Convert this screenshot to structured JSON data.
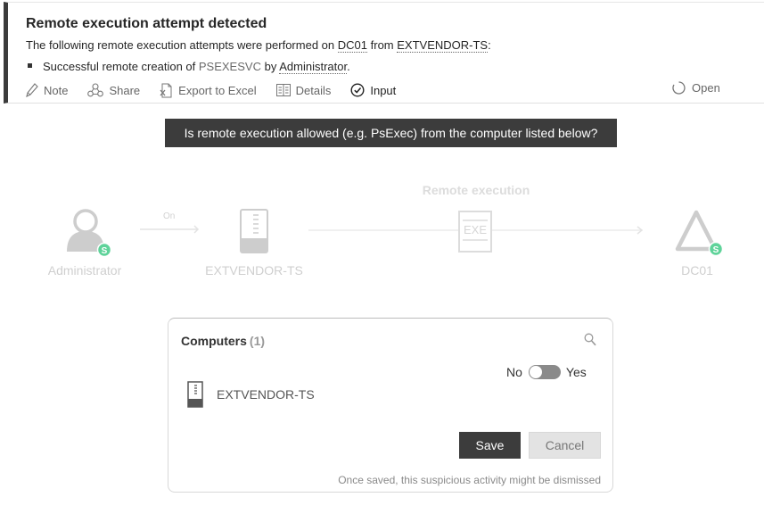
{
  "alert": {
    "title": "Remote execution attempt detected",
    "subtitle_prefix": "The following remote execution attempts were performed on",
    "target_computer": "DC01",
    "from_word": "from",
    "source_computer": "EXTVENDOR-TS",
    "colon": ":",
    "bullet_prefix": "Successful remote creation of",
    "service": "PSEXESVC",
    "by_word": "by",
    "user": "Administrator",
    "period": "."
  },
  "toolbar": {
    "note": "Note",
    "share": "Share",
    "export": "Export to Excel",
    "details": "Details",
    "input": "Input",
    "open": "Open"
  },
  "question": "Is remote execution allowed (e.g. PsExec) from the computer listed below?",
  "diagram": {
    "title": "Remote execution",
    "on_label": "On",
    "user_label": "Administrator",
    "source_label": "EXTVENDOR-TS",
    "target_label": "DC01",
    "exe_text": "EXE",
    "badge_letter": "S"
  },
  "panel": {
    "title": "Computers",
    "count": "(1)",
    "toggle_no": "No",
    "toggle_yes": "Yes",
    "computer_name": "EXTVENDOR-TS",
    "save_label": "Save",
    "cancel_label": "Cancel",
    "note": "Once saved, this suspicious activity might be dismissed"
  },
  "colors": {
    "dark": "#3c3c3c",
    "badge_green": "#3fbf7f",
    "faded_gray": "#d0d0d0"
  }
}
